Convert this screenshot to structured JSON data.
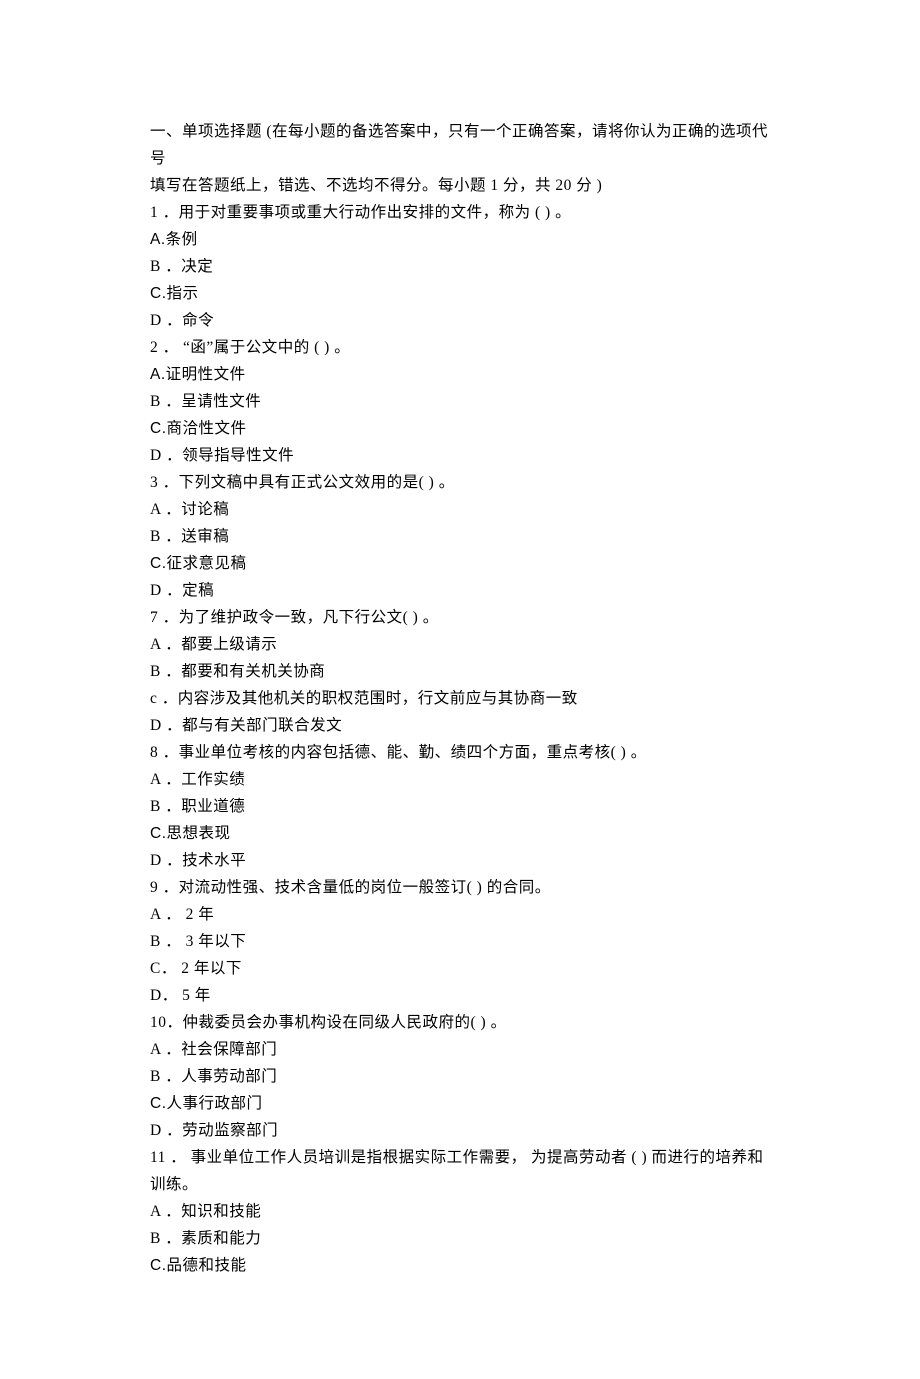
{
  "lines": [
    "一、单项选择题 (在每小题的备选答案中，只有一个正确答案，请将你认为正确的选项代号",
    "填写在答题纸上，错选、不选均不得分。每小题 1 分，共 20 分 )",
    "1 ．用于对重要事项或重大行动作出安排的文件，称为 ( ) 。",
    "A.条例",
    "B ．决定",
    "C.指示",
    "D ．命令",
    "2 ． “函”属于公文中的 ( ) 。",
    "A.证明性文件",
    "B ．呈请性文件",
    "C.商洽性文件",
    "D ．领导指导性文件",
    "3 ．下列文稿中具有正式公文效用的是( ) 。",
    "A ．讨论稿",
    "B ．送审稿",
    "C.征求意见稿",
    "D ．定稿",
    "7 ．为了维护政令一致，凡下行公文( ) 。",
    "A ．都要上级请示",
    "B ．都要和有关机关协商",
    "c ．内容涉及其他机关的职权范围时，行文前应与其协商一致",
    "D ．都与有关部门联合发文",
    "8 ．事业单位考核的内容包括德、能、勤、绩四个方面，重点考核( ) 。",
    "A ．工作实绩",
    "B ．职业道德",
    "C.思想表现",
    "D ．技术水平",
    "9 ．对流动性强、技术含量低的岗位一般签订( ) 的合同。",
    "A ． 2 年",
    "B ． 3 年以下",
    "C． 2 年以下",
    "D． 5 年",
    "10．仲裁委员会办事机构设在同级人民政府的( ) 。",
    "A ．社会保障部门",
    "B ．人事劳动部门",
    "C.人事行政部门",
    "D ．劳动监察部门",
    "11 ． 事业单位工作人员培训是指根据实际工作需要， 为提高劳动者 ( ) 而进行的培养和训练。",
    "A ．知识和技能",
    "B ．素质和能力",
    "C.品德和技能"
  ]
}
